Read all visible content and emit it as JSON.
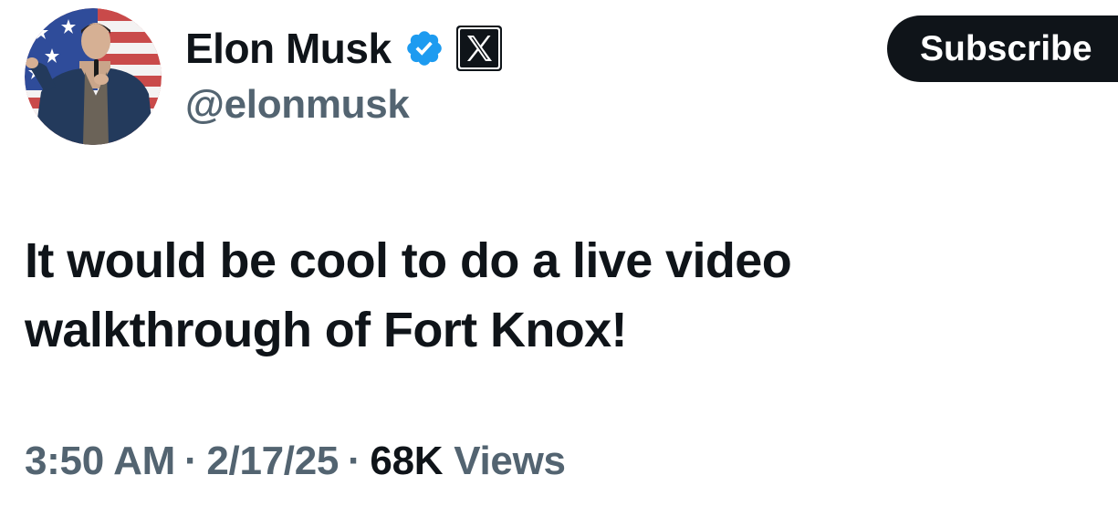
{
  "author": {
    "display_name": "Elon Musk",
    "handle": "@elonmusk",
    "avatar_icon": "profile-photo",
    "verified_icon": "verified-badge-icon",
    "affiliation_icon": "x-logo-icon",
    "verified_color": "#1d9bf0"
  },
  "actions": {
    "subscribe_label": "Subscribe"
  },
  "tweet": {
    "text_line1": "It would be cool to do a live video",
    "text_line2": "walkthrough of Fort Knox!"
  },
  "meta": {
    "time": "3:50 AM",
    "separator": "·",
    "date": "2/17/25",
    "views_count": "68K",
    "views_label": "Views"
  },
  "colors": {
    "text_primary": "#0f1419",
    "text_secondary": "#536471",
    "button_bg": "#0f1419",
    "button_text": "#ffffff"
  }
}
